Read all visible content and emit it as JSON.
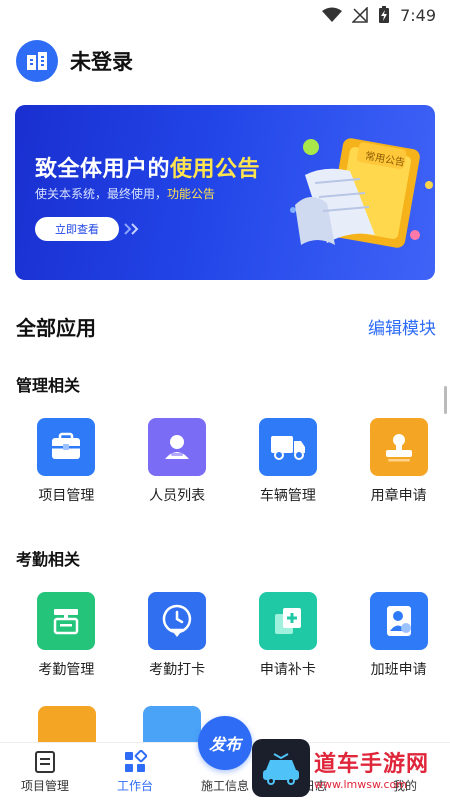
{
  "status_bar": {
    "time": "7:49"
  },
  "header": {
    "login_status": "未登录"
  },
  "banner": {
    "title_prefix": "致全体用户的",
    "title_highlight": "使用公告",
    "subtitle_prefix": "使关本系统，最终使用，",
    "subtitle_link": "功能公告",
    "button_label": "立即查看",
    "card_label": "常用公告"
  },
  "apps_section": {
    "title": "全部应用",
    "edit_label": "编辑模块"
  },
  "groups": [
    {
      "title": "管理相关",
      "items": [
        {
          "label": "项目管理",
          "icon": "briefcase-icon",
          "color": "#2f7bf7"
        },
        {
          "label": "人员列表",
          "icon": "person-card-icon",
          "color": "#7b6cf6"
        },
        {
          "label": "车辆管理",
          "icon": "truck-icon",
          "color": "#2f7bf7"
        },
        {
          "label": "用章申请",
          "icon": "seal-icon",
          "color": "#f5a524"
        }
      ]
    },
    {
      "title": "考勤相关",
      "items": [
        {
          "label": "考勤管理",
          "icon": "attendance-board-icon",
          "color": "#24c47a"
        },
        {
          "label": "考勤打卡",
          "icon": "clock-pin-icon",
          "color": "#2f6ff0"
        },
        {
          "label": "申请补卡",
          "icon": "add-card-icon",
          "color": "#1fc9a5"
        },
        {
          "label": "加班申请",
          "icon": "overtime-person-icon",
          "color": "#2f7bf7"
        }
      ]
    }
  ],
  "bottom_nav": {
    "items": [
      {
        "label": "项目管理",
        "icon": "document-icon"
      },
      {
        "label": "工作台",
        "icon": "grid-icon",
        "active": true
      },
      {
        "label": "施工信息",
        "icon": "construction-icon"
      },
      {
        "label": "日志",
        "icon": "log-icon"
      },
      {
        "label": "我的",
        "icon": "profile-icon"
      }
    ],
    "publish_label": "发布"
  },
  "watermark": {
    "main": "道车手游网",
    "url": "www.lmwsw.com"
  },
  "colors": {
    "accent": "#2e6cf6",
    "banner_highlight": "#ffe44d"
  }
}
